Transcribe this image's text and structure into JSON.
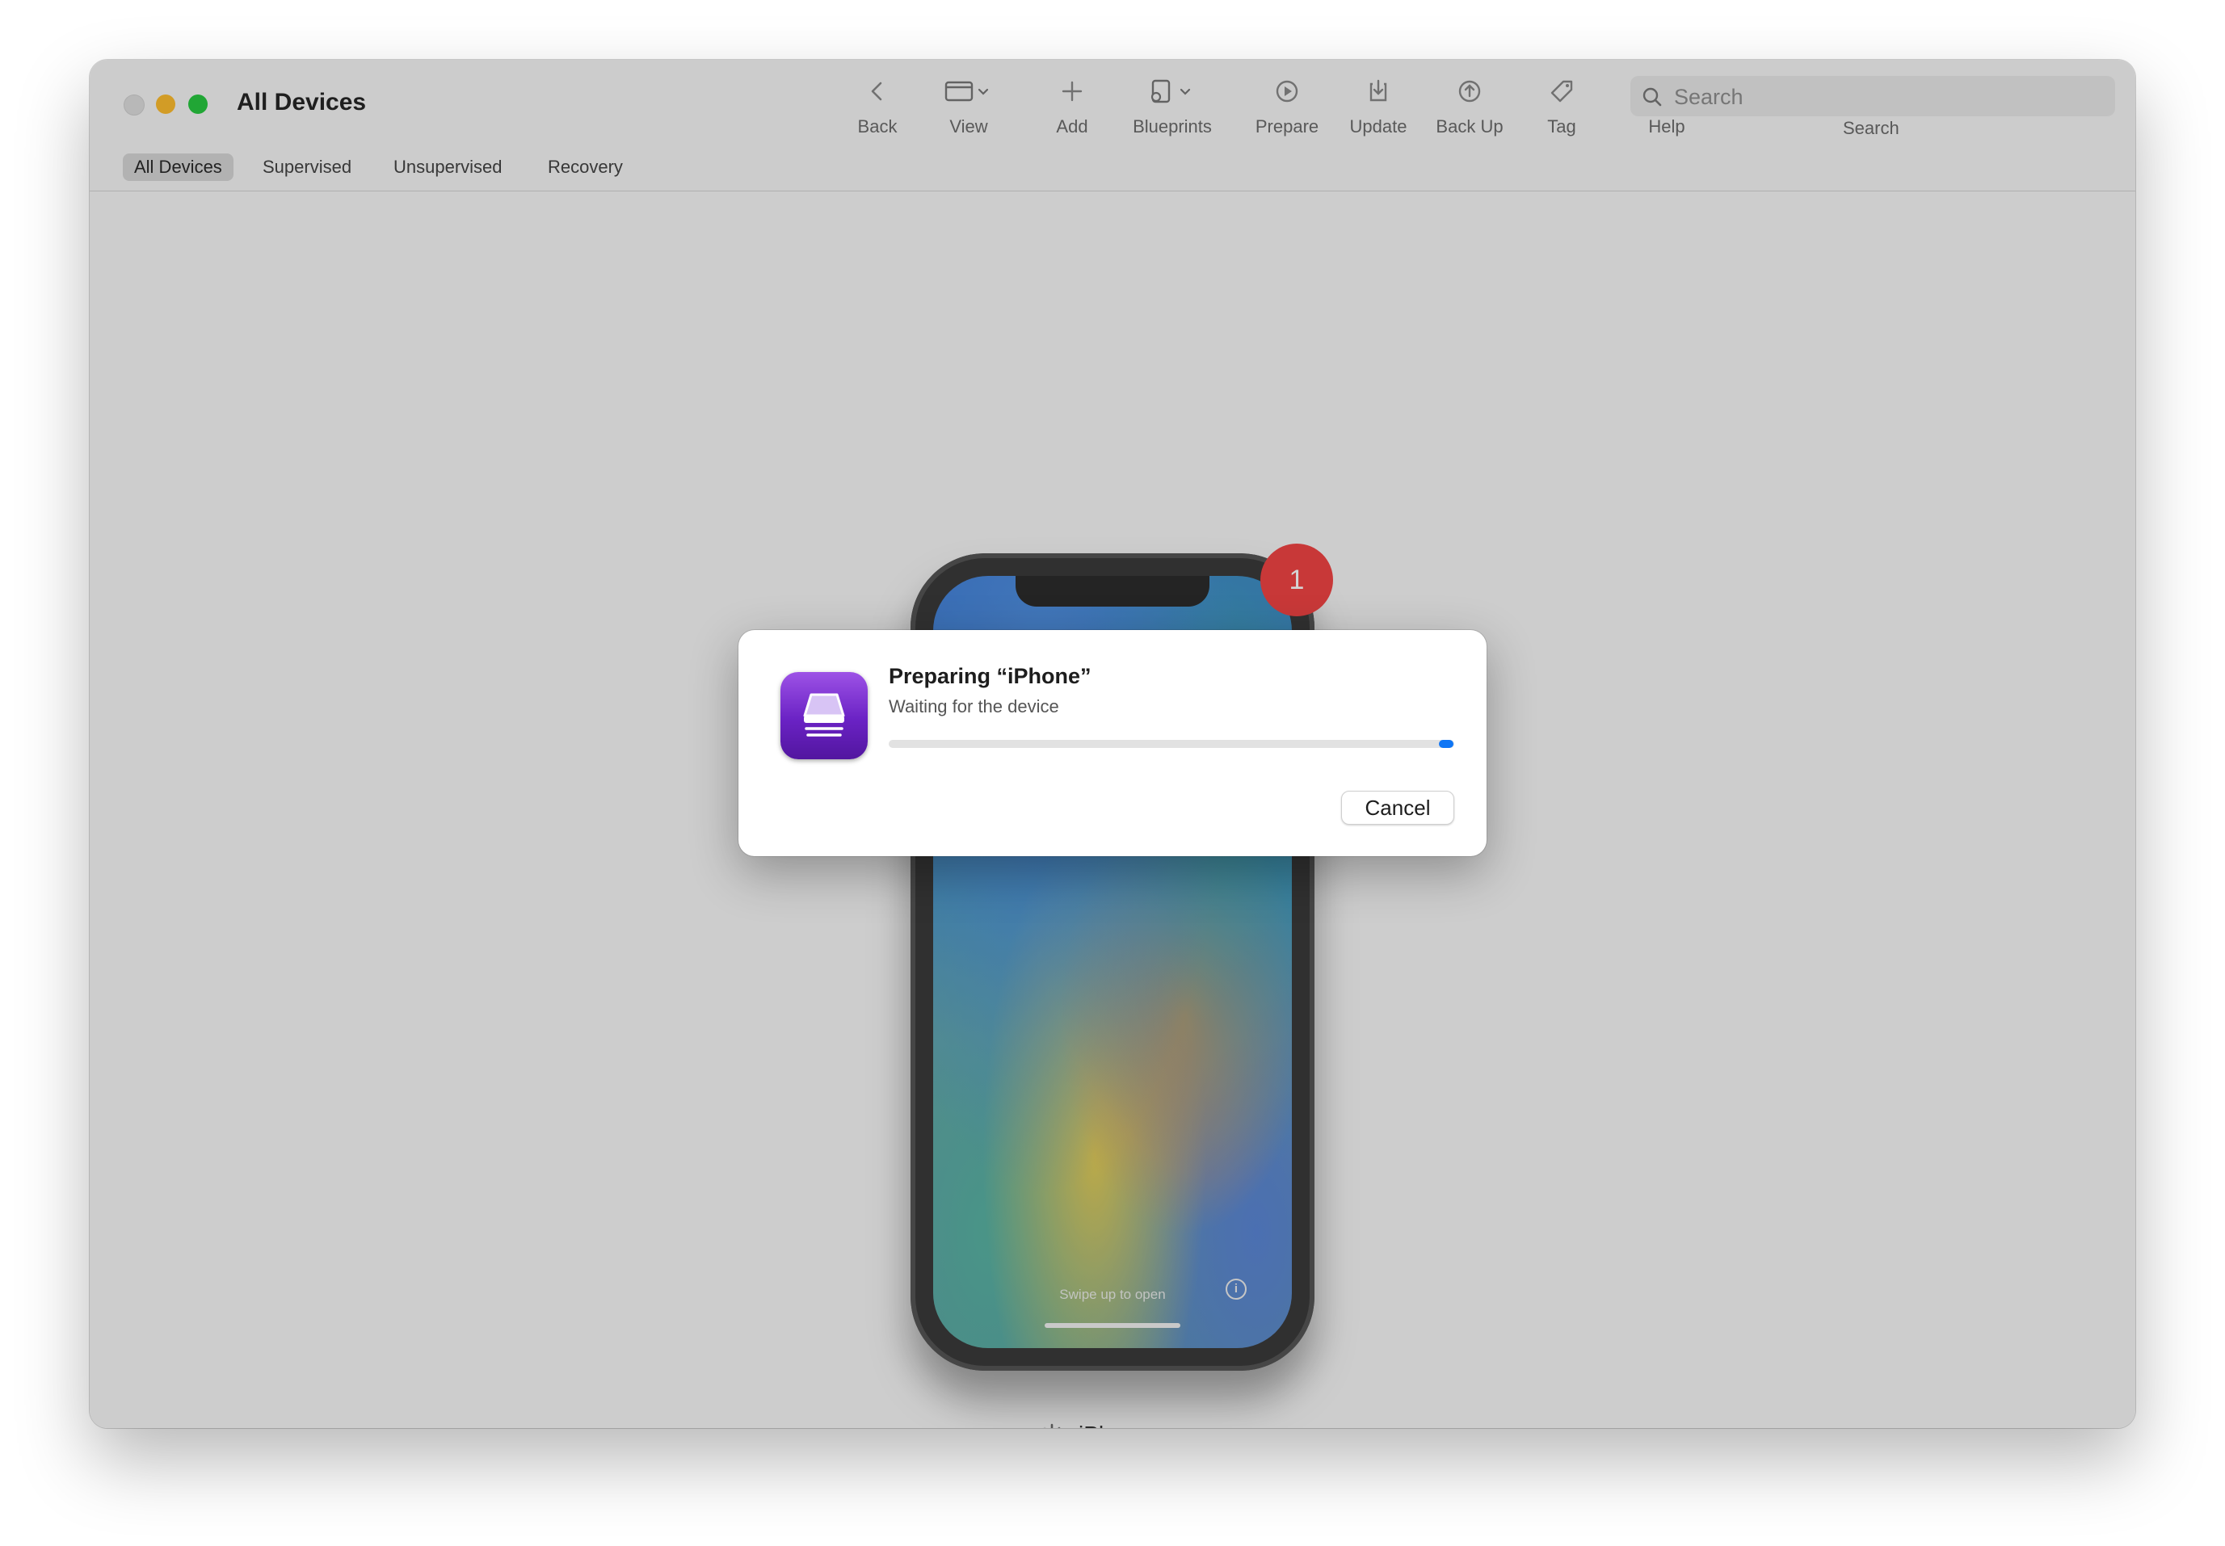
{
  "window": {
    "title": "All Devices",
    "traffic_lights": {
      "close": "#dedede",
      "minimize": "#fdbc2e",
      "maximize": "#28c840"
    }
  },
  "toolbar": {
    "back": "Back",
    "view": "View",
    "add": "Add",
    "blueprints": "Blueprints",
    "prepare": "Prepare",
    "update": "Update",
    "back_up": "Back Up",
    "tag": "Tag",
    "help": "Help",
    "search_placeholder": "Search",
    "search_label": "Search"
  },
  "scope_bar": {
    "items": [
      "All Devices",
      "Supervised",
      "Unsupervised",
      "Recovery"
    ],
    "selected": "All Devices"
  },
  "device": {
    "name": "iPhone",
    "lock_screen_text": "Swipe up to open",
    "badge_count": "1",
    "badge_color": "#f14444"
  },
  "dialog": {
    "title": "Preparing “iPhone”",
    "status": "Waiting for the device",
    "progress": {
      "indeterminate": true,
      "position": 0.985,
      "color": "#0f76f5"
    },
    "cancel_label": "Cancel"
  },
  "icons": [
    "back-chevron-icon",
    "view-icon",
    "add-icon",
    "blueprints-icon",
    "prepare-icon",
    "update-icon",
    "back-up-icon",
    "tag-icon",
    "help-icon",
    "search-icon",
    "info-icon",
    "spinner-icon",
    "apple-configurator-icon"
  ]
}
